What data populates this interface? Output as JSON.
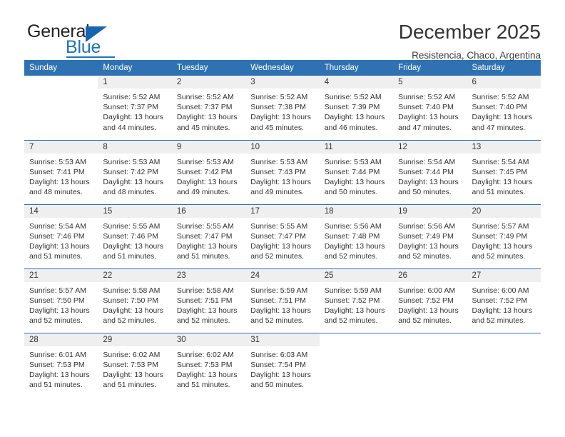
{
  "brand": {
    "name_part1": "General",
    "name_part2": "Blue",
    "triangle_icon": "triangle-icon",
    "accent_color": "#1a74c0"
  },
  "header": {
    "title": "December 2025",
    "subtitle": "Resistencia, Chaco, Argentina"
  },
  "calendar": {
    "header_bg": "#2f72b3",
    "daynum_bg": "#efefef",
    "weekday_headers": [
      "Sunday",
      "Monday",
      "Tuesday",
      "Wednesday",
      "Thursday",
      "Friday",
      "Saturday"
    ],
    "weeks": [
      [
        {
          "day": ""
        },
        {
          "day": "1",
          "sunrise": "Sunrise: 5:52 AM",
          "sunset": "Sunset: 7:37 PM",
          "daylight1": "Daylight: 13 hours",
          "daylight2": "and 44 minutes."
        },
        {
          "day": "2",
          "sunrise": "Sunrise: 5:52 AM",
          "sunset": "Sunset: 7:37 PM",
          "daylight1": "Daylight: 13 hours",
          "daylight2": "and 45 minutes."
        },
        {
          "day": "3",
          "sunrise": "Sunrise: 5:52 AM",
          "sunset": "Sunset: 7:38 PM",
          "daylight1": "Daylight: 13 hours",
          "daylight2": "and 45 minutes."
        },
        {
          "day": "4",
          "sunrise": "Sunrise: 5:52 AM",
          "sunset": "Sunset: 7:39 PM",
          "daylight1": "Daylight: 13 hours",
          "daylight2": "and 46 minutes."
        },
        {
          "day": "5",
          "sunrise": "Sunrise: 5:52 AM",
          "sunset": "Sunset: 7:40 PM",
          "daylight1": "Daylight: 13 hours",
          "daylight2": "and 47 minutes."
        },
        {
          "day": "6",
          "sunrise": "Sunrise: 5:52 AM",
          "sunset": "Sunset: 7:40 PM",
          "daylight1": "Daylight: 13 hours",
          "daylight2": "and 47 minutes."
        }
      ],
      [
        {
          "day": "7",
          "sunrise": "Sunrise: 5:53 AM",
          "sunset": "Sunset: 7:41 PM",
          "daylight1": "Daylight: 13 hours",
          "daylight2": "and 48 minutes."
        },
        {
          "day": "8",
          "sunrise": "Sunrise: 5:53 AM",
          "sunset": "Sunset: 7:42 PM",
          "daylight1": "Daylight: 13 hours",
          "daylight2": "and 48 minutes."
        },
        {
          "day": "9",
          "sunrise": "Sunrise: 5:53 AM",
          "sunset": "Sunset: 7:42 PM",
          "daylight1": "Daylight: 13 hours",
          "daylight2": "and 49 minutes."
        },
        {
          "day": "10",
          "sunrise": "Sunrise: 5:53 AM",
          "sunset": "Sunset: 7:43 PM",
          "daylight1": "Daylight: 13 hours",
          "daylight2": "and 49 minutes."
        },
        {
          "day": "11",
          "sunrise": "Sunrise: 5:53 AM",
          "sunset": "Sunset: 7:44 PM",
          "daylight1": "Daylight: 13 hours",
          "daylight2": "and 50 minutes."
        },
        {
          "day": "12",
          "sunrise": "Sunrise: 5:54 AM",
          "sunset": "Sunset: 7:44 PM",
          "daylight1": "Daylight: 13 hours",
          "daylight2": "and 50 minutes."
        },
        {
          "day": "13",
          "sunrise": "Sunrise: 5:54 AM",
          "sunset": "Sunset: 7:45 PM",
          "daylight1": "Daylight: 13 hours",
          "daylight2": "and 51 minutes."
        }
      ],
      [
        {
          "day": "14",
          "sunrise": "Sunrise: 5:54 AM",
          "sunset": "Sunset: 7:46 PM",
          "daylight1": "Daylight: 13 hours",
          "daylight2": "and 51 minutes."
        },
        {
          "day": "15",
          "sunrise": "Sunrise: 5:55 AM",
          "sunset": "Sunset: 7:46 PM",
          "daylight1": "Daylight: 13 hours",
          "daylight2": "and 51 minutes."
        },
        {
          "day": "16",
          "sunrise": "Sunrise: 5:55 AM",
          "sunset": "Sunset: 7:47 PM",
          "daylight1": "Daylight: 13 hours",
          "daylight2": "and 51 minutes."
        },
        {
          "day": "17",
          "sunrise": "Sunrise: 5:55 AM",
          "sunset": "Sunset: 7:47 PM",
          "daylight1": "Daylight: 13 hours",
          "daylight2": "and 52 minutes."
        },
        {
          "day": "18",
          "sunrise": "Sunrise: 5:56 AM",
          "sunset": "Sunset: 7:48 PM",
          "daylight1": "Daylight: 13 hours",
          "daylight2": "and 52 minutes."
        },
        {
          "day": "19",
          "sunrise": "Sunrise: 5:56 AM",
          "sunset": "Sunset: 7:49 PM",
          "daylight1": "Daylight: 13 hours",
          "daylight2": "and 52 minutes."
        },
        {
          "day": "20",
          "sunrise": "Sunrise: 5:57 AM",
          "sunset": "Sunset: 7:49 PM",
          "daylight1": "Daylight: 13 hours",
          "daylight2": "and 52 minutes."
        }
      ],
      [
        {
          "day": "21",
          "sunrise": "Sunrise: 5:57 AM",
          "sunset": "Sunset: 7:50 PM",
          "daylight1": "Daylight: 13 hours",
          "daylight2": "and 52 minutes."
        },
        {
          "day": "22",
          "sunrise": "Sunrise: 5:58 AM",
          "sunset": "Sunset: 7:50 PM",
          "daylight1": "Daylight: 13 hours",
          "daylight2": "and 52 minutes."
        },
        {
          "day": "23",
          "sunrise": "Sunrise: 5:58 AM",
          "sunset": "Sunset: 7:51 PM",
          "daylight1": "Daylight: 13 hours",
          "daylight2": "and 52 minutes."
        },
        {
          "day": "24",
          "sunrise": "Sunrise: 5:59 AM",
          "sunset": "Sunset: 7:51 PM",
          "daylight1": "Daylight: 13 hours",
          "daylight2": "and 52 minutes."
        },
        {
          "day": "25",
          "sunrise": "Sunrise: 5:59 AM",
          "sunset": "Sunset: 7:52 PM",
          "daylight1": "Daylight: 13 hours",
          "daylight2": "and 52 minutes."
        },
        {
          "day": "26",
          "sunrise": "Sunrise: 6:00 AM",
          "sunset": "Sunset: 7:52 PM",
          "daylight1": "Daylight: 13 hours",
          "daylight2": "and 52 minutes."
        },
        {
          "day": "27",
          "sunrise": "Sunrise: 6:00 AM",
          "sunset": "Sunset: 7:52 PM",
          "daylight1": "Daylight: 13 hours",
          "daylight2": "and 52 minutes."
        }
      ],
      [
        {
          "day": "28",
          "sunrise": "Sunrise: 6:01 AM",
          "sunset": "Sunset: 7:53 PM",
          "daylight1": "Daylight: 13 hours",
          "daylight2": "and 51 minutes."
        },
        {
          "day": "29",
          "sunrise": "Sunrise: 6:02 AM",
          "sunset": "Sunset: 7:53 PM",
          "daylight1": "Daylight: 13 hours",
          "daylight2": "and 51 minutes."
        },
        {
          "day": "30",
          "sunrise": "Sunrise: 6:02 AM",
          "sunset": "Sunset: 7:53 PM",
          "daylight1": "Daylight: 13 hours",
          "daylight2": "and 51 minutes."
        },
        {
          "day": "31",
          "sunrise": "Sunrise: 6:03 AM",
          "sunset": "Sunset: 7:54 PM",
          "daylight1": "Daylight: 13 hours",
          "daylight2": "and 50 minutes."
        },
        {
          "day": ""
        },
        {
          "day": ""
        },
        {
          "day": ""
        }
      ]
    ]
  }
}
